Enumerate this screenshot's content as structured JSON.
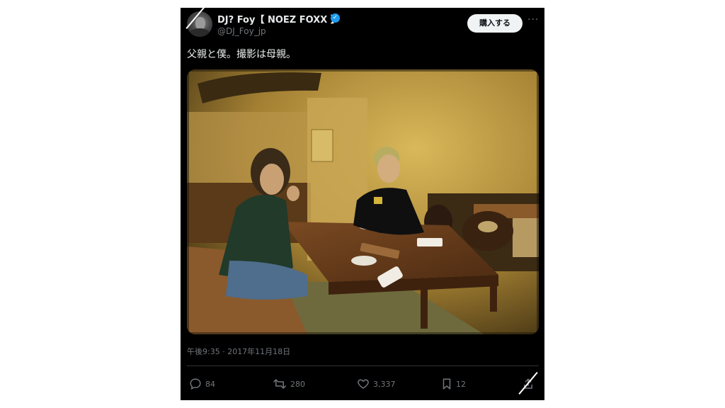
{
  "post": {
    "display_name": "DJ? Foy【 NOEZ FOXX 】",
    "handle": "@DJ_Foy_jp",
    "buy_label": "購入する",
    "more_label": "···",
    "text": "父親と僕。撮影は母親。",
    "timestamp": "午後9:35 · 2017年11月18日"
  },
  "actions": {
    "replies": "84",
    "reposts": "280",
    "likes": "3,337",
    "bookmarks": "12"
  },
  "icons": {
    "verified": "verified-badge-icon",
    "reply": "reply-icon",
    "repost": "repost-icon",
    "like": "heart-icon",
    "bookmark": "bookmark-icon",
    "share": "share-icon",
    "more": "more-icon"
  },
  "colors": {
    "background": "#000000",
    "text": "#e7e9ea",
    "secondary_text": "#71767b",
    "verified": "#1d9bf0",
    "button_bg": "#eff3f4"
  }
}
